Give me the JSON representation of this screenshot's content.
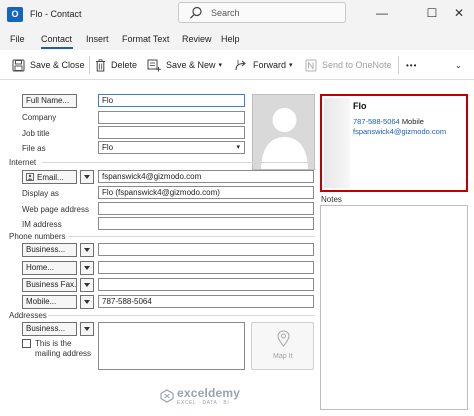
{
  "window": {
    "app_icon_letter": "O",
    "title": "Flo  -  Contact",
    "search_placeholder": "Search",
    "minimize_glyph": "—",
    "maximize_glyph": "☐",
    "close_glyph": "✕"
  },
  "menu": {
    "items": [
      "File",
      "Contact",
      "Insert",
      "Format Text",
      "Review",
      "Help"
    ],
    "active": "Contact"
  },
  "toolbar": {
    "save_close": "Save & Close",
    "delete": "Delete",
    "save_new": "Save & New",
    "forward": "Forward",
    "send_onenote": "Send to OneNote",
    "more": "•••"
  },
  "form": {
    "full_name_button": "Full Name...",
    "full_name_value": "Flo",
    "company_label": "Company",
    "company_value": "",
    "job_title_label": "Job title",
    "job_title_value": "",
    "file_as_label": "File as",
    "file_as_value": "Flo",
    "internet_header": "Internet",
    "email_button": "Email...",
    "email_value": "fspanswick4@gizmodo.com",
    "display_as_label": "Display as",
    "display_as_value": "Flo (fspanswick4@gizmodo.com)",
    "web_page_label": "Web page address",
    "web_page_value": "",
    "im_label": "IM address",
    "im_value": "",
    "phone_header": "Phone numbers",
    "phones": [
      {
        "type": "Business...",
        "value": ""
      },
      {
        "type": "Home...",
        "value": ""
      },
      {
        "type": "Business Fax...",
        "value": ""
      },
      {
        "type": "Mobile...",
        "value": "787-588-5064"
      }
    ],
    "addresses_header": "Addresses",
    "address_type": "Business...",
    "address_value": "",
    "mailing_checkbox_label_1": "This is the",
    "mailing_checkbox_label_2": "mailing address",
    "mailing_checked": false,
    "map_it_label": "Map It"
  },
  "card": {
    "name": "Flo",
    "phone": "787-588-5064",
    "phone_type": "Mobile",
    "email": "fspanswick4@gizmodo.com"
  },
  "notes": {
    "label": "Notes",
    "value": ""
  },
  "watermark": {
    "name": "exceldemy",
    "tagline": "EXCEL · DATA · BI"
  },
  "colors": {
    "accent": "#1f5fa8",
    "card_highlight": "#c00000",
    "link": "#1a5fb4"
  }
}
